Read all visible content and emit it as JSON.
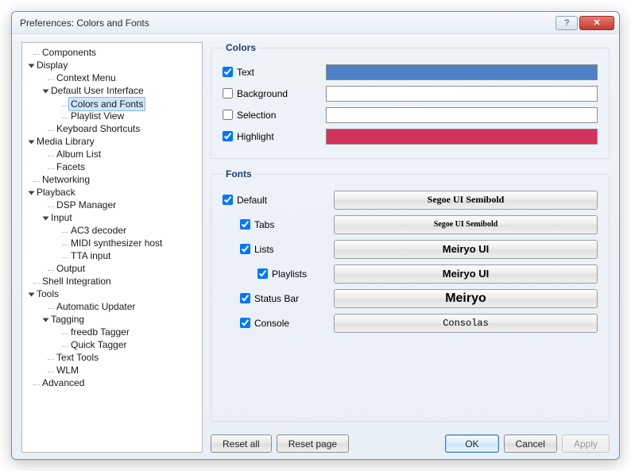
{
  "window": {
    "title": "Preferences: Colors and Fonts"
  },
  "tree": {
    "components": "Components",
    "display": "Display",
    "context_menu": "Context Menu",
    "dui": "Default User Interface",
    "colors_fonts": "Colors and Fonts",
    "playlist_view": "Playlist View",
    "kbd": "Keyboard Shortcuts",
    "media_lib": "Media Library",
    "album_list": "Album List",
    "facets": "Facets",
    "networking": "Networking",
    "playback": "Playback",
    "dsp": "DSP Manager",
    "input": "Input",
    "ac3": "AC3 decoder",
    "midi": "MIDI synthesizer host",
    "tta": "TTA input",
    "output": "Output",
    "shell": "Shell Integration",
    "tools": "Tools",
    "autoup": "Automatic Updater",
    "tagging": "Tagging",
    "freedb": "freedb Tagger",
    "quick": "Quick Tagger",
    "texttools": "Text Tools",
    "wlm": "WLM",
    "advanced": "Advanced"
  },
  "colors": {
    "legend": "Colors",
    "rows": {
      "text": {
        "label": "Text",
        "checked": true,
        "color": "#4f7fc5"
      },
      "background": {
        "label": "Background",
        "checked": false,
        "color": "#ffffff"
      },
      "selection": {
        "label": "Selection",
        "checked": false,
        "color": "#ffffff"
      },
      "highlight": {
        "label": "Highlight",
        "checked": true,
        "color": "#d1325a"
      }
    }
  },
  "fonts": {
    "legend": "Fonts",
    "rows": {
      "default": {
        "label": "Default",
        "checked": true,
        "font": "Segoe UI Semibold",
        "family": "Segoe UI",
        "weight": "600",
        "size": "12px"
      },
      "tabs": {
        "label": "Tabs",
        "checked": true,
        "font": "Segoe UI Semibold",
        "family": "Segoe UI",
        "weight": "600",
        "size": "10px"
      },
      "lists": {
        "label": "Lists",
        "checked": true,
        "font": "Meiryo UI",
        "family": "Meiryo UI, Meiryo, sans-serif",
        "weight": "700",
        "size": "13px"
      },
      "playlists": {
        "label": "Playlists",
        "checked": true,
        "font": "Meiryo UI",
        "family": "Meiryo UI, Meiryo, sans-serif",
        "weight": "700",
        "size": "13px"
      },
      "status": {
        "label": "Status Bar",
        "checked": true,
        "font": "Meiryo",
        "family": "Meiryo, sans-serif",
        "weight": "700",
        "size": "16px"
      },
      "console": {
        "label": "Console",
        "checked": true,
        "font": "Consolas",
        "family": "Consolas, monospace",
        "weight": "400",
        "size": "12px"
      }
    }
  },
  "buttons": {
    "reset_all": "Reset all",
    "reset_page": "Reset page",
    "ok": "OK",
    "cancel": "Cancel",
    "apply": "Apply"
  }
}
